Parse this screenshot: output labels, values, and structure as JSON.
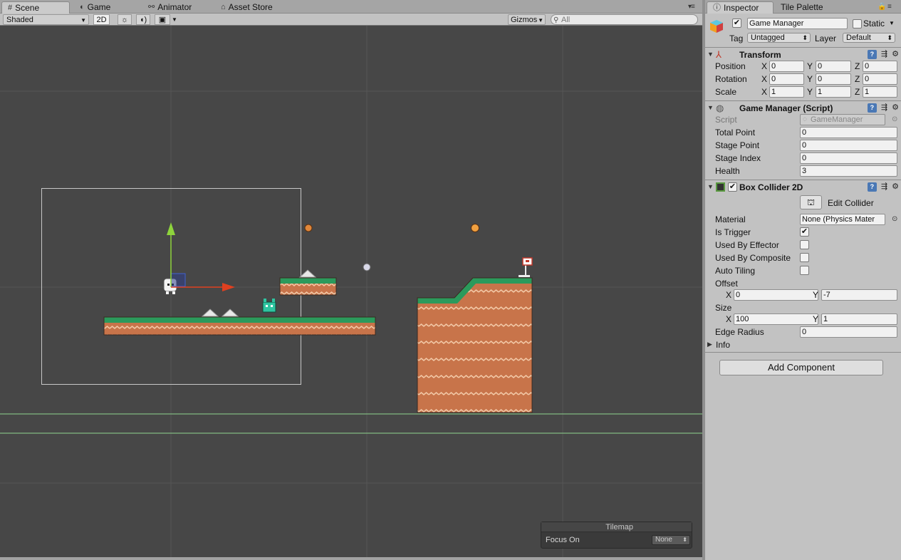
{
  "scene_tabs": [
    {
      "label": "Scene",
      "icon": "grid-icon"
    },
    {
      "label": "Game",
      "icon": "gamepad-icon"
    },
    {
      "label": "Animator",
      "icon": "animator-icon"
    },
    {
      "label": "Asset Store",
      "icon": "store-icon"
    }
  ],
  "toolbar": {
    "draw_mode": "Shaded",
    "mode_2d": "2D",
    "gizmos": "Gizmos",
    "search_placeholder": "All"
  },
  "tilemap_overlay": {
    "title": "Tilemap",
    "focus_label": "Focus On",
    "focus_value": "None"
  },
  "inspector_tabs": [
    {
      "label": "Inspector",
      "icon": "info-icon"
    },
    {
      "label": "Tile Palette"
    }
  ],
  "object": {
    "name": "Game Manager",
    "active": true,
    "static_label": "Static",
    "static": false,
    "tag_label": "Tag",
    "tag": "Untagged",
    "layer_label": "Layer",
    "layer": "Default"
  },
  "transform": {
    "title": "Transform",
    "position": {
      "label": "Position",
      "x": "0",
      "y": "0",
      "z": "0"
    },
    "rotation": {
      "label": "Rotation",
      "x": "0",
      "y": "0",
      "z": "0"
    },
    "scale": {
      "label": "Scale",
      "x": "1",
      "y": "1",
      "z": "1"
    }
  },
  "game_manager_script": {
    "title": "Game Manager (Script)",
    "script_label": "Script",
    "script_value": "GameManager",
    "fields": [
      {
        "label": "Total Point",
        "value": "0"
      },
      {
        "label": "Stage Point",
        "value": "0"
      },
      {
        "label": "Stage Index",
        "value": "0"
      },
      {
        "label": "Health",
        "value": "3"
      }
    ]
  },
  "box_collider": {
    "title": "Box Collider 2D",
    "enabled": true,
    "edit_collider_label": "Edit Collider",
    "material_label": "Material",
    "material_value": "None (Physics Mater",
    "is_trigger_label": "Is Trigger",
    "is_trigger": true,
    "used_by_effector_label": "Used By Effector",
    "used_by_composite_label": "Used By Composite",
    "auto_tiling_label": "Auto Tiling",
    "offset_label": "Offset",
    "offset": {
      "x": "0",
      "y": "-7"
    },
    "size_label": "Size",
    "size": {
      "x": "100",
      "y": "1"
    },
    "edge_radius_label": "Edge Radius",
    "edge_radius": "0",
    "info_label": "Info"
  },
  "add_component_label": "Add Component",
  "axis_labels": {
    "x": "X",
    "y": "Y",
    "z": "Z"
  }
}
